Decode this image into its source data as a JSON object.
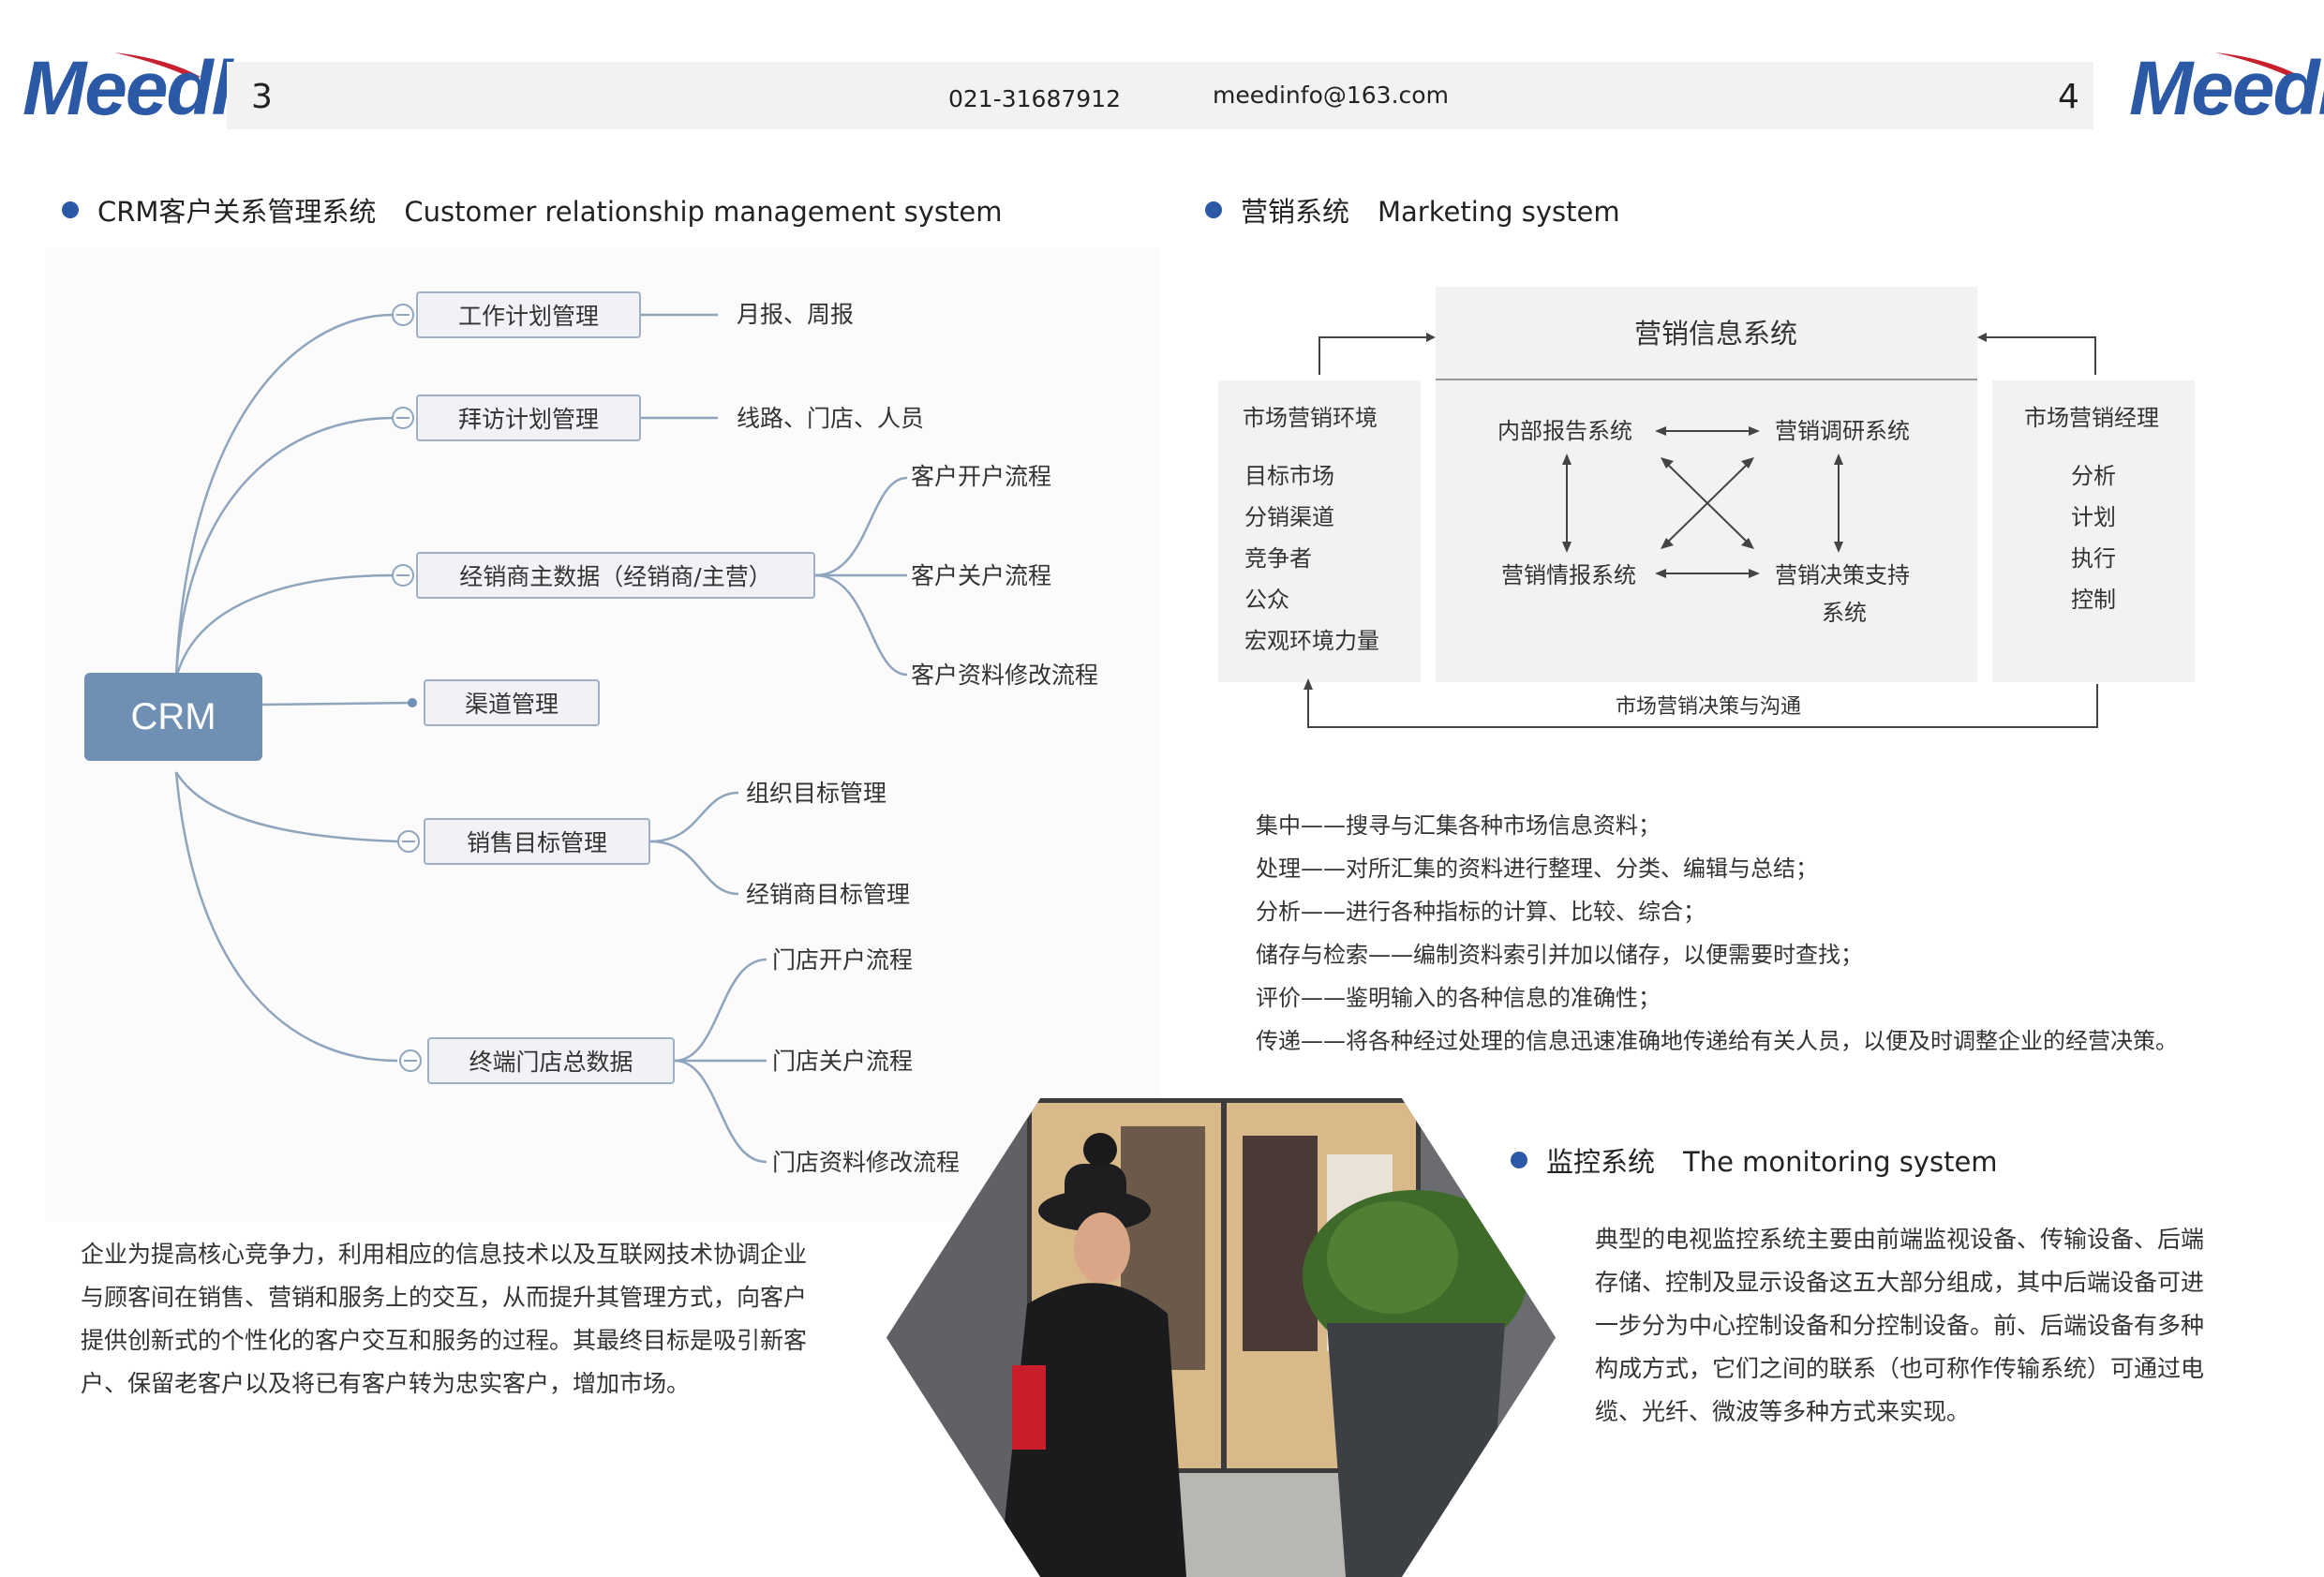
{
  "header": {
    "logo_text": "Meedl",
    "page_left": "3",
    "page_right": "4",
    "phone": "021-31687912",
    "email": "meedinfo@163.com"
  },
  "crm": {
    "title_cn": "CRM客户关系管理系统",
    "title_en": "Customer relationship management system",
    "root": "CRM",
    "nodes": [
      {
        "label": "工作计划管理",
        "leaves": [
          "月报、周报"
        ]
      },
      {
        "label": "拜访计划管理",
        "leaves": [
          "线路、门店、人员"
        ]
      },
      {
        "label": "经销商主数据（经销商/主营）",
        "leaves": [
          "客户开户流程",
          "客户关户流程",
          "客户资料修改流程"
        ]
      },
      {
        "label": "渠道管理",
        "leaves": []
      },
      {
        "label": "销售目标管理",
        "leaves": [
          "组织目标管理",
          "经销商目标管理"
        ]
      },
      {
        "label": "终端门店总数据",
        "leaves": [
          "门店开户流程",
          "门店关户流程",
          "门店资料修改流程"
        ]
      }
    ],
    "paragraph": [
      "企业为提高核心竞争力，利用相应的信息技术以及互联网技术协调企业",
      "与顾客间在销售、营销和服务上的交互，从而提升其管理方式，向客户",
      "提供创新式的个性化的客户交互和服务的过程。其最终目标是吸引新客",
      "户、保留老客户以及将已有客户转为忠实客户，增加市场。"
    ]
  },
  "marketing": {
    "title_cn": "营销系统",
    "title_en": "Marketing system",
    "center_title": "营销信息系统",
    "left_title": "市场营销环境",
    "left_items": [
      "目标市场",
      "分销渠道",
      "竞争者",
      "公众",
      "宏观环境力量"
    ],
    "right_title": "市场营销经理",
    "right_items": [
      "分析",
      "计划",
      "执行",
      "控制"
    ],
    "internal": "内部报告系统",
    "research": "营销调研系统",
    "intel": "营销情报系统",
    "decision_line1": "营销决策支持",
    "decision_line2": "系统",
    "bottom_label": "市场营销决策与沟通",
    "descriptions": [
      "集中——搜寻与汇集各种市场信息资料；",
      "处理——对所汇集的资料进行整理、分类、编辑与总结；",
      "分析——进行各种指标的计算、比较、综合；",
      "储存与检索——编制资料索引并加以储存，以便需要时查找；",
      "评价——鉴明输入的各种信息的准确性；",
      "传递——将各种经过处理的信息迅速准确地传递给有关人员，以便及时调整企业的经营决策。"
    ]
  },
  "monitoring": {
    "title_cn": "监控系统",
    "title_en": "The monitoring system",
    "paragraph": [
      "典型的电视监控系统主要由前端监视设备、传输设备、后端",
      "存储、控制及显示设备这五大部分组成，其中后端设备可进",
      "一步分为中心控制设备和分控制设备。前、后端设备有多种",
      "构成方式，它们之间的联系（也可称作传输系统）可通过电",
      "缆、光纤、微波等多种方式来实现。"
    ]
  },
  "colors": {
    "brand_blue": "#2c59a6",
    "swoosh_red": "#c8202f",
    "crm_root": "#6f90b3"
  }
}
